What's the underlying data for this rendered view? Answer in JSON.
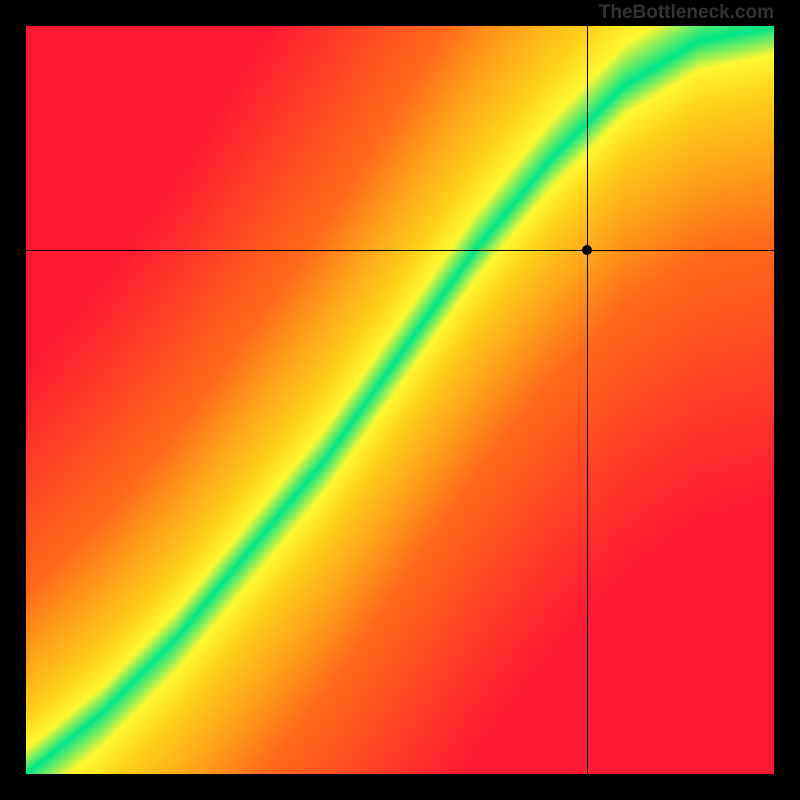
{
  "watermark": "TheBottleneck.com",
  "chart_data": {
    "type": "heatmap",
    "title": "",
    "xlabel": "",
    "ylabel": "",
    "xlim": [
      0,
      100
    ],
    "ylim": [
      0,
      100
    ],
    "crosshair": {
      "x": 75,
      "y": 70
    },
    "marker": {
      "x": 75,
      "y": 70
    },
    "description": "Bottleneck heatmap. Green diagonal band indicates optimal CPU/GPU balance; red corners indicate severe bottleneck. Crosshair and marker show the user's current configuration position.",
    "ideal_band": [
      {
        "x": 0,
        "y": 0
      },
      {
        "x": 10,
        "y": 8
      },
      {
        "x": 20,
        "y": 18
      },
      {
        "x": 30,
        "y": 30
      },
      {
        "x": 40,
        "y": 42
      },
      {
        "x": 50,
        "y": 56
      },
      {
        "x": 60,
        "y": 70
      },
      {
        "x": 70,
        "y": 82
      },
      {
        "x": 80,
        "y": 92
      },
      {
        "x": 90,
        "y": 98
      },
      {
        "x": 100,
        "y": 100
      }
    ],
    "color_scale": {
      "worst": "#ff1a33",
      "bad": "#ff6a1a",
      "mid": "#ffd21a",
      "good": "#fff833",
      "best": "#00e68a"
    }
  }
}
